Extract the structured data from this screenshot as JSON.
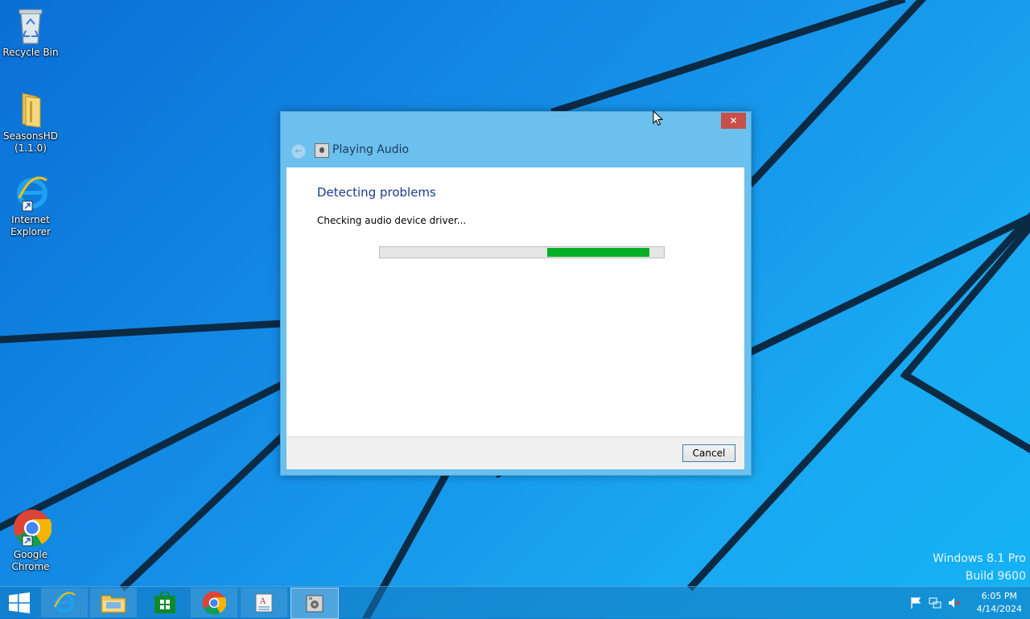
{
  "desktop": {
    "icons": [
      {
        "label": "Recycle Bin"
      },
      {
        "label": "SeasonsHD\n(1.1.0)"
      },
      {
        "label": "Internet\nExplorer"
      },
      {
        "label": "Google\nChrome"
      }
    ]
  },
  "dialog": {
    "title": "Playing Audio",
    "close_label": "✕",
    "heading": "Detecting problems",
    "status": "Checking audio device driver...",
    "progress": {
      "start_fraction": 0.59,
      "end_fraction": 0.95,
      "color": "#06b025"
    },
    "cancel_label": "Cancel"
  },
  "watermark": {
    "line1": "Windows 8.1 Pro",
    "line2": "Build 9600"
  },
  "taskbar": {
    "items": [
      "start-button",
      "internet-explorer-icon",
      "file-explorer-icon",
      "store-icon",
      "chrome-icon",
      "document-app-icon",
      "troubleshooter-icon"
    ],
    "clock": {
      "time": "6:05 PM",
      "date": "4/14/2024"
    }
  },
  "colors": {
    "accent": "#6cc0ee",
    "close": "#c7504a",
    "heading": "#1a3d8e"
  }
}
